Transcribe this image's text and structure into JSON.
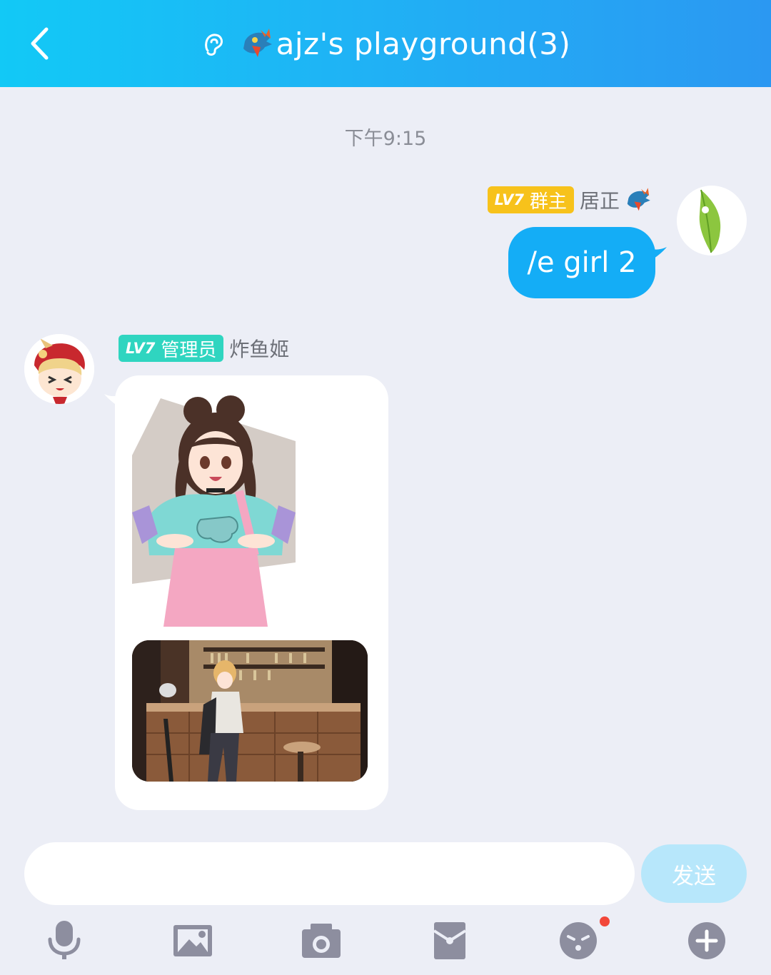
{
  "header": {
    "title": "ajz's playground(3)",
    "back_icon": "chevron-left-icon",
    "ear_icon": "ear-icon",
    "background": "#1fb3f5"
  },
  "chat": {
    "timestamp": "下午9:15",
    "messages": [
      {
        "side": "right",
        "level": "LV7",
        "role": "群主",
        "sender": "居正",
        "text": "/e girl 2",
        "bubble_color": "#14adf6"
      },
      {
        "side": "left",
        "level": "LV7",
        "role": "管理员",
        "sender": "炸鱼姬"
      }
    ]
  },
  "input": {
    "value": "",
    "send_label": "发送"
  },
  "toolbar": {
    "icons": [
      "microphone-icon",
      "image-icon",
      "camera-icon",
      "red-packet-icon",
      "emoji-icon",
      "plus-icon"
    ],
    "emoji_has_notification": true
  }
}
